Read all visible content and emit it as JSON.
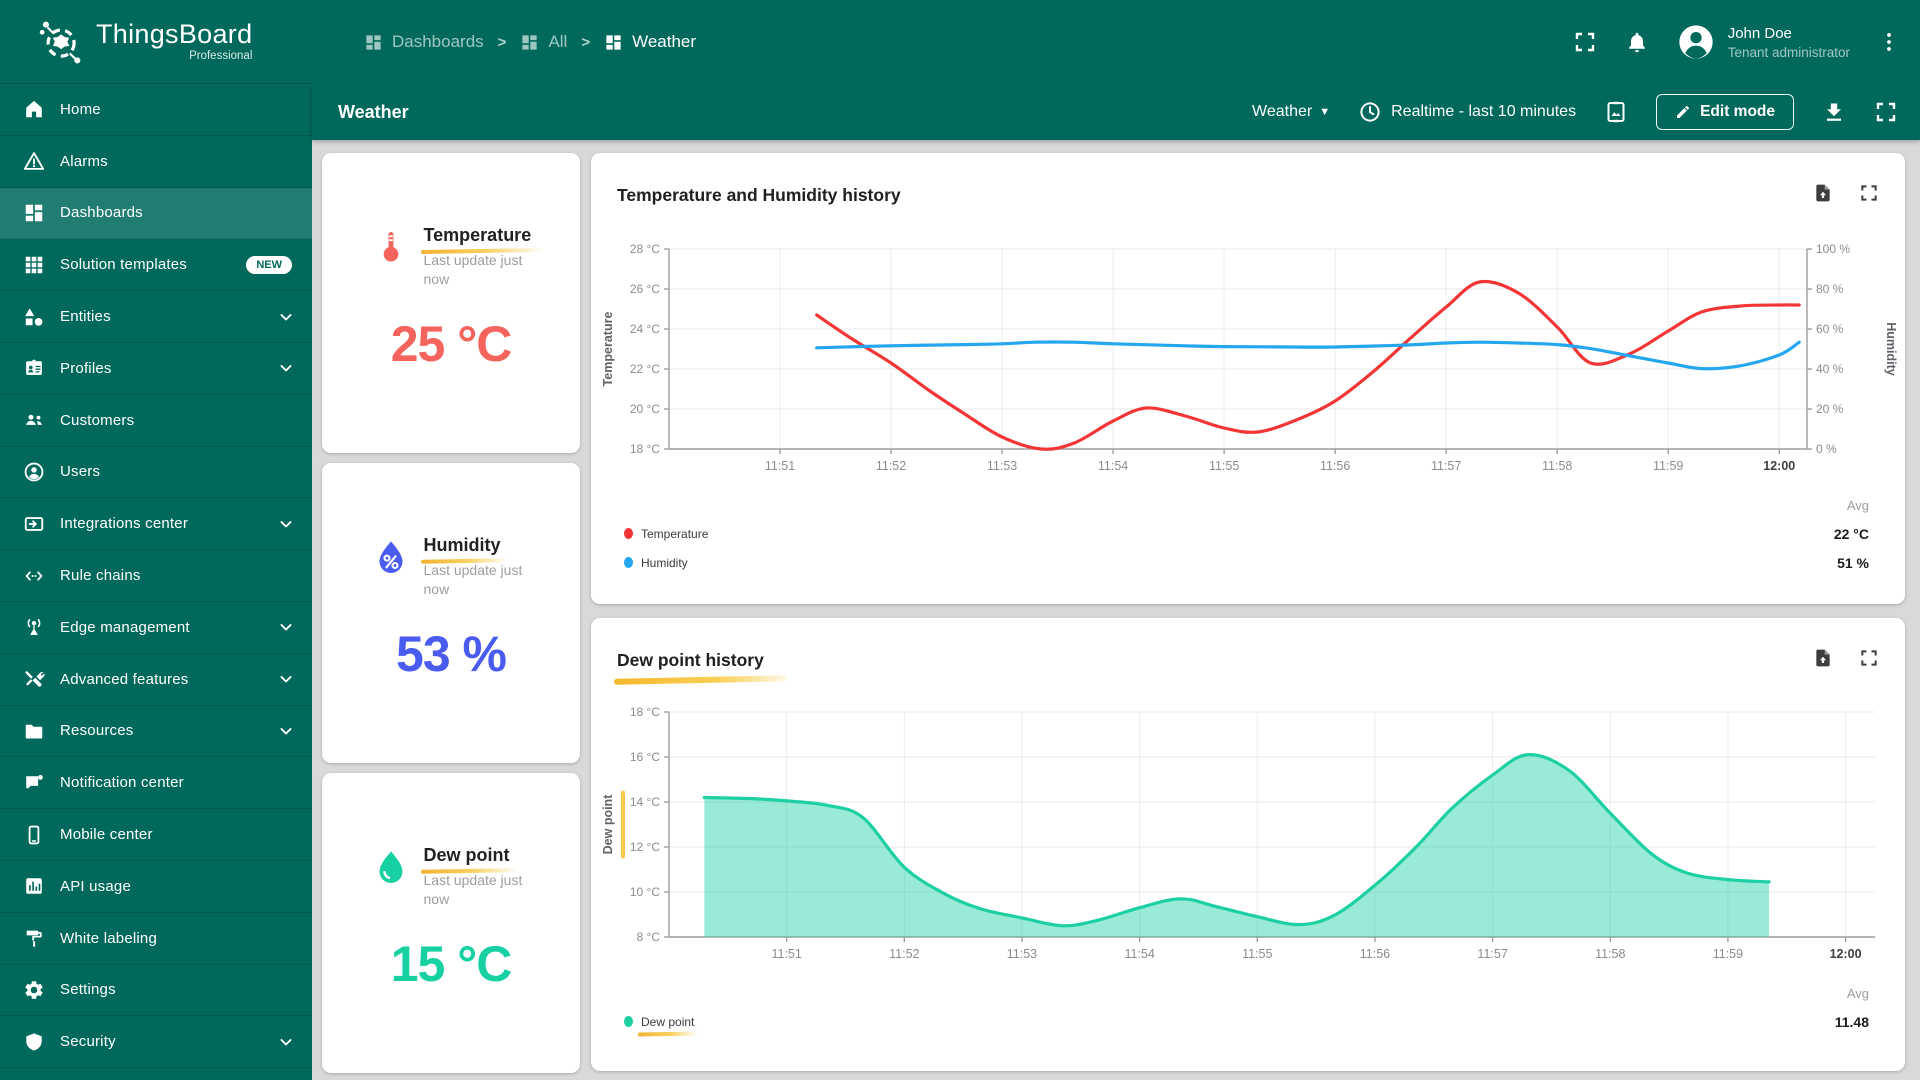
{
  "app": {
    "accent_color": "#00695c",
    "background_color": "#d9d9d9"
  },
  "header": {
    "logo_title": "ThingsBoard",
    "logo_subtitle": "Professional",
    "breadcrumb": [
      {
        "label": "Dashboards",
        "icon": "dashboards-icon"
      },
      {
        "label": "All",
        "icon": "dashboards-icon"
      },
      {
        "label": "Weather",
        "icon": "dashboards-icon"
      }
    ],
    "icons": [
      "fullscreen-icon",
      "notifications-bell-icon",
      "avatar",
      "more-vert-icon"
    ],
    "user": {
      "name": "John Doe",
      "role": "Tenant administrator"
    }
  },
  "subheader": {
    "title": "Weather",
    "state_selector": "Weather",
    "timewindow": "Realtime - last 10 minutes",
    "edit_button": "Edit mode",
    "icons": [
      "clock-icon",
      "screenshot-icon",
      "pencil-icon",
      "download-icon",
      "fullscreen-icon"
    ]
  },
  "sidebar": {
    "items": [
      {
        "label": "Home",
        "icon": "home-icon"
      },
      {
        "label": "Alarms",
        "icon": "alarm-icon"
      },
      {
        "label": "Dashboards",
        "icon": "dashboards-icon",
        "active": true
      },
      {
        "label": "Solution templates",
        "icon": "solution-templates-icon",
        "badge": "NEW"
      },
      {
        "label": "Entities",
        "icon": "entities-icon",
        "expandable": true
      },
      {
        "label": "Profiles",
        "icon": "profiles-icon",
        "expandable": true
      },
      {
        "label": "Customers",
        "icon": "customers-icon"
      },
      {
        "label": "Users",
        "icon": "users-icon"
      },
      {
        "label": "Integrations center",
        "icon": "integrations-icon",
        "expandable": true
      },
      {
        "label": "Rule chains",
        "icon": "rule-chains-icon"
      },
      {
        "label": "Edge management",
        "icon": "edge-management-icon",
        "expandable": true
      },
      {
        "label": "Advanced features",
        "icon": "advanced-features-icon",
        "expandable": true
      },
      {
        "label": "Resources",
        "icon": "resources-icon",
        "expandable": true
      },
      {
        "label": "Notification center",
        "icon": "notification-center-icon"
      },
      {
        "label": "Mobile center",
        "icon": "mobile-center-icon"
      },
      {
        "label": "API usage",
        "icon": "api-usage-icon"
      },
      {
        "label": "White labeling",
        "icon": "white-labeling-icon"
      },
      {
        "label": "Settings",
        "icon": "settings-icon"
      },
      {
        "label": "Security",
        "icon": "security-icon",
        "expandable": true
      }
    ]
  },
  "stat_cards": [
    {
      "title": "Temperature",
      "subtitle": "Last update just now",
      "value": "25 °C",
      "color": "#f4645c",
      "icon": "thermometer-icon"
    },
    {
      "title": "Humidity",
      "subtitle": "Last update just now",
      "value": "53 %",
      "color": "#4a5cf0",
      "icon": "humidity-percent-drop-icon"
    },
    {
      "title": "Dew point",
      "subtitle": "Last update just now",
      "value": "15 °C",
      "color": "#17d1a2",
      "icon": "water-drop-icon"
    }
  ],
  "chart_data": [
    {
      "type": "line",
      "title": "Temperature and Humidity history",
      "x_ticks": [
        "11:51",
        "11:52",
        "11:53",
        "11:54",
        "11:55",
        "11:56",
        "11:57",
        "11:58",
        "11:59",
        "12:00"
      ],
      "x_domain_minutes_after_1150": [
        0,
        10.25
      ],
      "left_axis": {
        "label": "Temperature",
        "unit": "°C",
        "range": [
          18,
          28
        ],
        "ticks": [
          18,
          20,
          22,
          24,
          26,
          28
        ]
      },
      "right_axis": {
        "label": "Humidity",
        "unit": "%",
        "range": [
          0,
          100
        ],
        "ticks": [
          0,
          20,
          40,
          60,
          80,
          100
        ]
      },
      "grid": true,
      "series": [
        {
          "name": "Temperature",
          "color": "#f43535",
          "axis": "left",
          "points": [
            [
              1.33,
              24.7
            ],
            [
              1.65,
              23.5
            ],
            [
              2.0,
              22.3
            ],
            [
              2.35,
              20.9
            ],
            [
              2.65,
              19.8
            ],
            [
              3.0,
              18.6
            ],
            [
              3.35,
              18.0
            ],
            [
              3.65,
              18.3
            ],
            [
              4.0,
              19.4
            ],
            [
              4.3,
              20.05
            ],
            [
              4.65,
              19.65
            ],
            [
              5.0,
              19.05
            ],
            [
              5.3,
              18.85
            ],
            [
              5.65,
              19.45
            ],
            [
              6.0,
              20.4
            ],
            [
              6.35,
              21.9
            ],
            [
              6.65,
              23.4
            ],
            [
              7.0,
              25.1
            ],
            [
              7.3,
              26.35
            ],
            [
              7.65,
              25.8
            ],
            [
              8.0,
              24.1
            ],
            [
              8.3,
              22.3
            ],
            [
              8.65,
              22.75
            ],
            [
              9.0,
              23.9
            ],
            [
              9.3,
              24.85
            ],
            [
              9.65,
              25.15
            ],
            [
              10.0,
              25.2
            ],
            [
              10.18,
              25.2
            ]
          ]
        },
        {
          "name": "Humidity",
          "color": "#24a6f1",
          "axis": "right",
          "points": [
            [
              1.33,
              50.6
            ],
            [
              2.0,
              51.6
            ],
            [
              2.65,
              52.2
            ],
            [
              3.0,
              52.6
            ],
            [
              3.3,
              53.4
            ],
            [
              3.65,
              53.4
            ],
            [
              4.0,
              52.6
            ],
            [
              4.65,
              51.6
            ],
            [
              5.0,
              51.2
            ],
            [
              5.65,
              51.0
            ],
            [
              6.0,
              51.0
            ],
            [
              6.65,
              52.0
            ],
            [
              7.0,
              53.0
            ],
            [
              7.3,
              53.4
            ],
            [
              7.65,
              53.0
            ],
            [
              8.0,
              52.2
            ],
            [
              8.3,
              50.2
            ],
            [
              8.65,
              46.6
            ],
            [
              9.0,
              43.0
            ],
            [
              9.3,
              40.2
            ],
            [
              9.65,
              41.6
            ],
            [
              10.0,
              47.0
            ],
            [
              10.18,
              53.4
            ]
          ]
        }
      ],
      "legend_position": "bottom",
      "avg_label": "Avg",
      "legend": [
        {
          "name": "Temperature",
          "color": "#f43535",
          "avg": "22 °C"
        },
        {
          "name": "Humidity",
          "color": "#24a6f1",
          "avg": "51 %"
        }
      ]
    },
    {
      "type": "area",
      "title": "Dew point history",
      "title_highlighted": true,
      "x_ticks": [
        "11:51",
        "11:52",
        "11:53",
        "11:54",
        "11:55",
        "11:56",
        "11:57",
        "11:58",
        "11:59",
        "12:00"
      ],
      "x_domain_minutes_after_1150": [
        0,
        10.25
      ],
      "left_axis": {
        "label": "Dew point",
        "unit": "°C",
        "range": [
          8,
          18
        ],
        "ticks": [
          8,
          10,
          12,
          14,
          16,
          18
        ],
        "label_highlighted": true
      },
      "grid": true,
      "series": [
        {
          "name": "Dew point",
          "color": "#1dd0a4",
          "fill": "#1dd0a4",
          "fill_opacity": 0.45,
          "axis": "left",
          "area": true,
          "points": [
            [
              0.3,
              14.2
            ],
            [
              0.7,
              14.15
            ],
            [
              1.0,
              14.05
            ],
            [
              1.35,
              13.85
            ],
            [
              1.65,
              13.3
            ],
            [
              2.0,
              11.1
            ],
            [
              2.35,
              9.9
            ],
            [
              2.65,
              9.25
            ],
            [
              3.0,
              8.85
            ],
            [
              3.35,
              8.5
            ],
            [
              3.65,
              8.75
            ],
            [
              4.0,
              9.3
            ],
            [
              4.35,
              9.7
            ],
            [
              4.65,
              9.35
            ],
            [
              5.0,
              8.9
            ],
            [
              5.35,
              8.55
            ],
            [
              5.65,
              8.95
            ],
            [
              6.0,
              10.3
            ],
            [
              6.35,
              12.0
            ],
            [
              6.65,
              13.7
            ],
            [
              7.0,
              15.2
            ],
            [
              7.3,
              16.1
            ],
            [
              7.65,
              15.4
            ],
            [
              8.0,
              13.5
            ],
            [
              8.35,
              11.7
            ],
            [
              8.65,
              10.85
            ],
            [
              9.0,
              10.55
            ],
            [
              9.35,
              10.45
            ]
          ]
        }
      ],
      "legend_position": "bottom",
      "avg_label": "Avg",
      "legend": [
        {
          "name": "Dew point",
          "color": "#1dd0a4",
          "avg": "11.48",
          "highlighted": true
        }
      ]
    }
  ]
}
